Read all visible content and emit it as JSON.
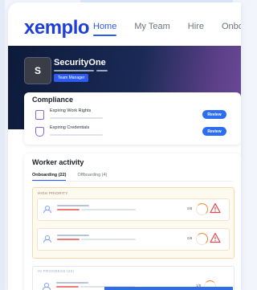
{
  "brand": {
    "logo": "xemplo"
  },
  "nav": {
    "items": [
      {
        "label": "Home",
        "active": true
      },
      {
        "label": "My Team",
        "active": false
      },
      {
        "label": "Hire",
        "active": false
      },
      {
        "label": "Onboard",
        "active": false
      }
    ]
  },
  "profile": {
    "avatar_letter": "S",
    "company": "SecurityOne",
    "role": "Team Manager"
  },
  "compliance": {
    "title": "Compliance",
    "items": [
      {
        "label": "Expiring Work Rights",
        "action": "Review",
        "icon": "document-icon"
      },
      {
        "label": "Expiring Credentials",
        "action": "Review",
        "icon": "shield-icon"
      }
    ]
  },
  "activity": {
    "title": "Worker activity",
    "tabs": [
      {
        "label": "Onboarding (22)",
        "active": true
      },
      {
        "label": "Offboarding (4)",
        "active": false
      }
    ],
    "high_priority": {
      "label": "HIGH PRIORITY",
      "rows": [
        {
          "count": "0/8"
        },
        {
          "count": "0/8"
        }
      ]
    },
    "normal": {
      "label": "IN PROGRESS (20)",
      "rows": [
        {
          "count": "1/8"
        }
      ]
    }
  },
  "colors": {
    "brand": "#1f3fd6",
    "accent": "#2d6ef0",
    "warning": "#f08a2c",
    "alert": "#e5484d"
  }
}
